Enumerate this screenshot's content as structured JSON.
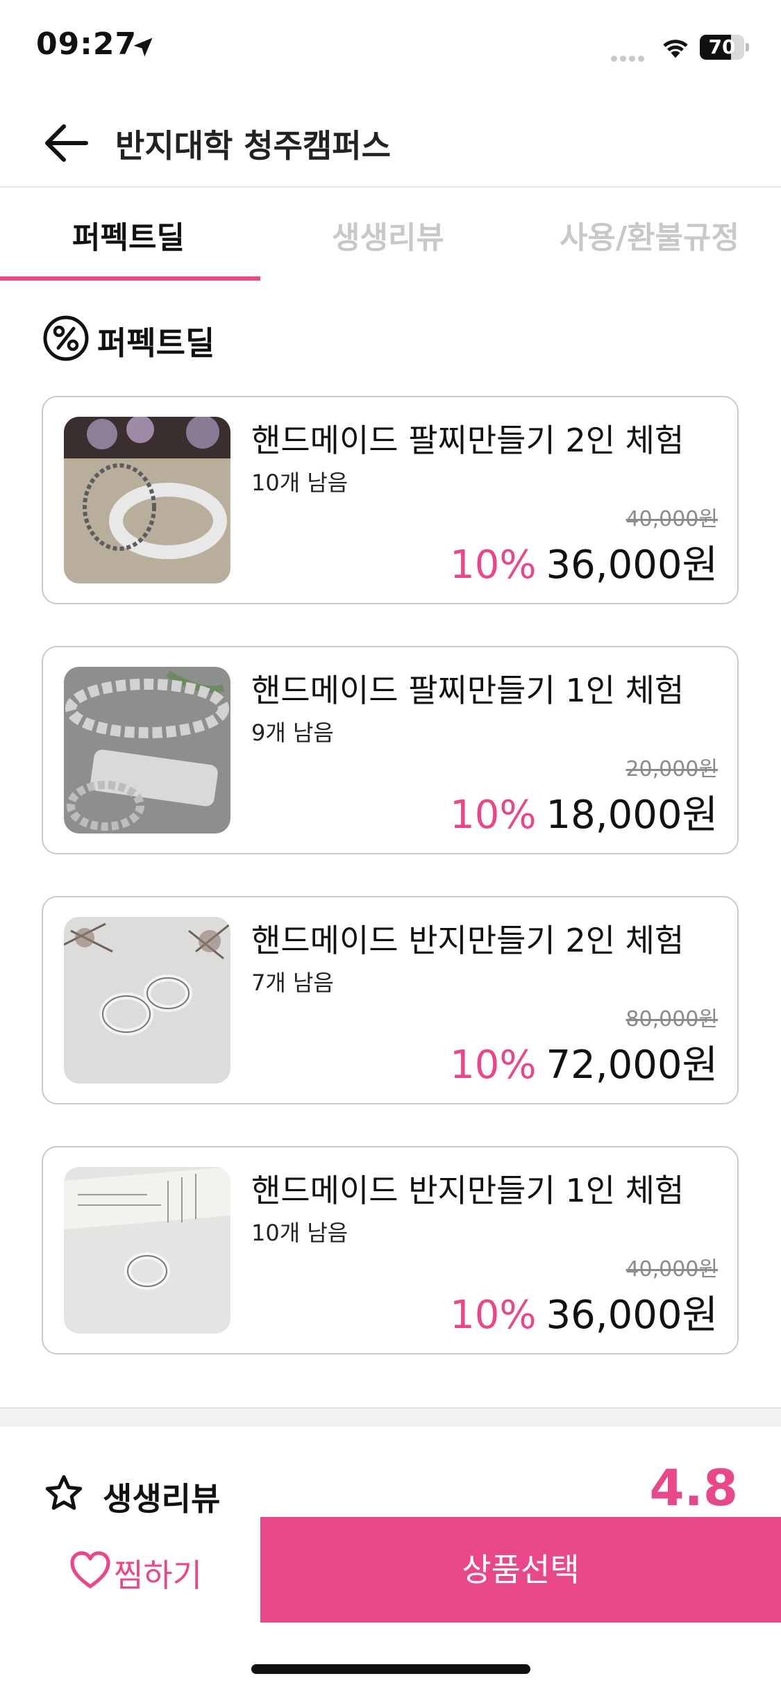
{
  "status_bar": {
    "time": "09:27",
    "battery": "70",
    "battery_level": 0.7,
    "icons": [
      "location-arrow-icon",
      "signal-dots-icon",
      "wifi-icon",
      "battery-icon"
    ]
  },
  "header": {
    "title": "반지대학 청주캠퍼스",
    "back_icon": "arrow-left-icon"
  },
  "tabs": [
    {
      "label": "퍼펙트딜",
      "active": true
    },
    {
      "label": "생생리뷰",
      "active": false
    },
    {
      "label": "사용/환불규정",
      "active": false
    }
  ],
  "section": {
    "icon": "percent-circle-icon",
    "title": "퍼펙트딜"
  },
  "products": [
    {
      "name": "핸드메이드 팔찌만들기 2인 체험",
      "stock": "10개 남음",
      "original_price": "40,000원",
      "discount": "10%",
      "price": "36,000원"
    },
    {
      "name": "핸드메이드 팔찌만들기 1인 체험",
      "stock": "9개 남음",
      "original_price": "20,000원",
      "discount": "10%",
      "price": "18,000원"
    },
    {
      "name": "핸드메이드 반지만들기 2인 체험",
      "stock": "7개 남음",
      "original_price": "80,000원",
      "discount": "10%",
      "price": "72,000원"
    },
    {
      "name": "핸드메이드 반지만들기 1인 체험",
      "stock": "10개 남음",
      "original_price": "40,000원",
      "discount": "10%",
      "price": "36,000원"
    }
  ],
  "review": {
    "icon": "star-outline-icon",
    "label": "생생리뷰",
    "score": "4.8"
  },
  "bottom_bar": {
    "wish_icon": "heart-outline-icon",
    "wish_label": "찜하기",
    "select_label": "상품선택"
  },
  "colors": {
    "accent": "#e8488a",
    "text": "#111111",
    "muted": "#c8c8c8",
    "border": "#c9c9c9"
  }
}
